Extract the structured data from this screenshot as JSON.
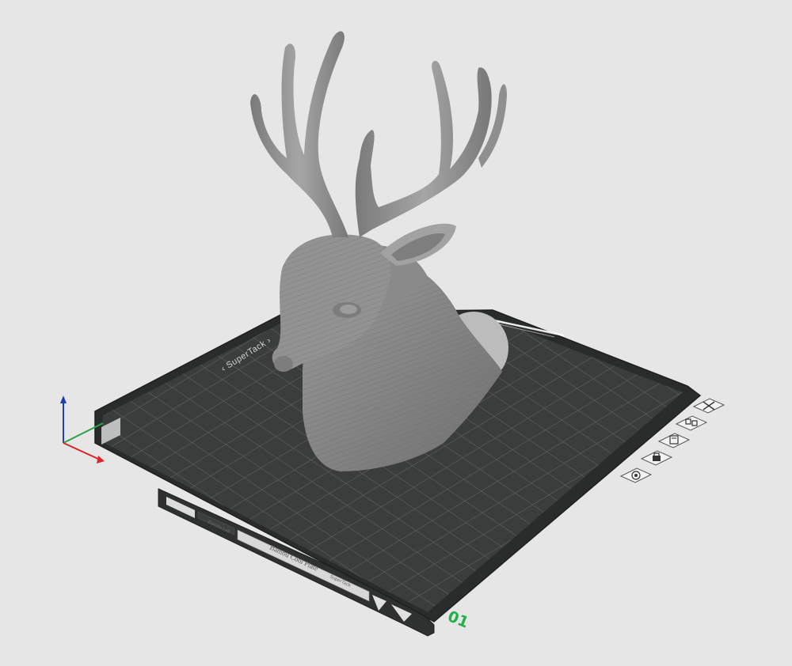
{
  "viewport": {
    "background": "#e6e6e6",
    "plate": {
      "number": "01",
      "brand": "SuperTack",
      "front_label": "Bambu Cool Plate",
      "front_sublabel": "SuperTack",
      "tab_label": "Bambu Lab",
      "number_color": "#1fb14a",
      "surface_color": "#3b3d3d",
      "grid_color": "#6a6c6c"
    },
    "model": {
      "name": "deer-head-bust",
      "color": "#8e8e8e"
    },
    "axes": {
      "x_color": "#d9262b",
      "y_color": "#2aa243",
      "z_color": "#1f3fb5"
    },
    "plate_toolbar": [
      {
        "name": "remove-plate-button",
        "icon": "close-icon"
      },
      {
        "name": "arrange-plate-button",
        "icon": "arrange-icon"
      },
      {
        "name": "auto-orient-button",
        "icon": "orient-icon"
      },
      {
        "name": "lock-plate-button",
        "icon": "lock-icon"
      },
      {
        "name": "plate-settings-button",
        "icon": "gear-icon"
      }
    ]
  }
}
